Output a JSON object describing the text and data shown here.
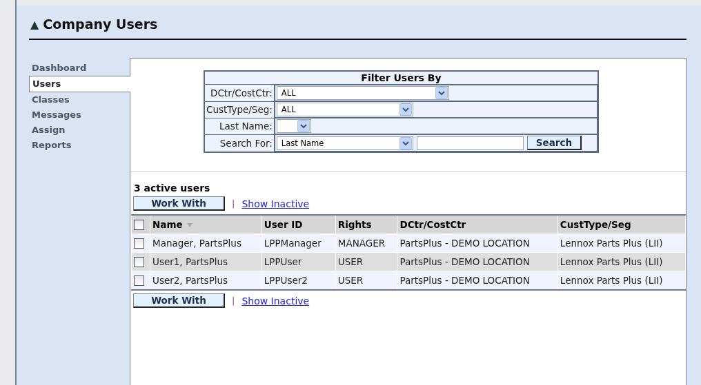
{
  "page": {
    "title_icon": "▲",
    "title": "Company Users"
  },
  "sidebar": {
    "items": [
      {
        "label": "Dashboard",
        "selected": false
      },
      {
        "label": "Users",
        "selected": true
      },
      {
        "label": "Classes",
        "selected": false
      },
      {
        "label": "Messages",
        "selected": false
      },
      {
        "label": "Assign",
        "selected": false
      },
      {
        "label": "Reports",
        "selected": false
      }
    ]
  },
  "filter": {
    "title": "Filter Users By",
    "rows": [
      {
        "label": "DCtr/CostCtr:",
        "kind": "select",
        "value": "ALL"
      },
      {
        "label": "CustType/Seg:",
        "kind": "select",
        "value": "ALL"
      },
      {
        "label": "Last Name:",
        "kind": "select"
      },
      {
        "label": "Search For:",
        "kind": "search",
        "value": "Last Name",
        "button": "Search"
      }
    ]
  },
  "results": {
    "count": "3 active users",
    "top_actions": {
      "button": "Work With",
      "separator": "|",
      "link": "Show Inactive"
    },
    "table": {
      "columns": [
        "Name",
        "User ID",
        "Rights",
        "DCtr/CostCtr",
        "CustType/Seg"
      ],
      "all_checked": false,
      "rows": [
        {
          "checked": false,
          "cells": [
            "Manager, PartsPlus",
            "LPPManager",
            "MANAGER",
            "PartsPlus - DEMO LOCATION",
            "Lennox Parts Plus (LII)"
          ]
        },
        {
          "checked": false,
          "cells": [
            "User1, PartsPlus",
            "LPPUser",
            "USER",
            "PartsPlus - DEMO LOCATION",
            "Lennox Parts Plus (LII)"
          ]
        },
        {
          "checked": false,
          "cells": [
            "User2, PartsPlus",
            "LPPUser2",
            "USER",
            "PartsPlus - DEMO LOCATION",
            "Lennox Parts Plus (LII)"
          ]
        }
      ]
    },
    "bottom_actions": {
      "button": "Work With",
      "separator": "|",
      "link": "Show Inactive"
    }
  }
}
